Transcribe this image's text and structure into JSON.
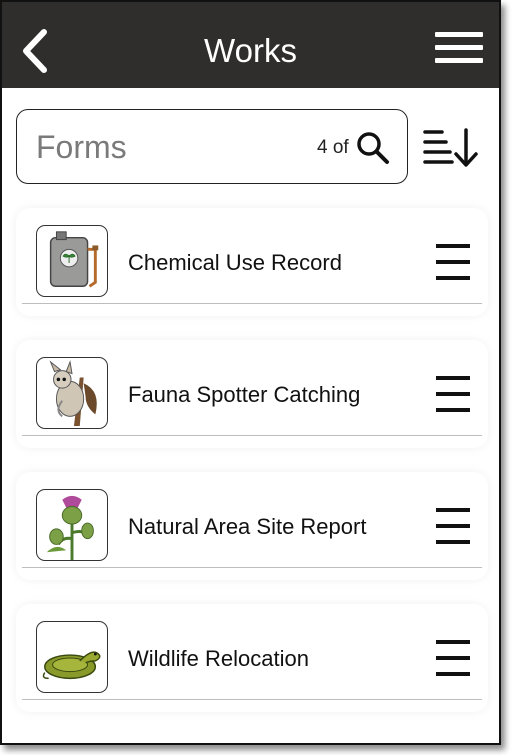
{
  "header": {
    "title": "Works"
  },
  "search": {
    "placeholder": "Forms",
    "count_text": "4 of"
  },
  "items": [
    {
      "label": "Chemical Use Record",
      "icon": "chemical-sprayer-icon"
    },
    {
      "label": "Fauna Spotter Catching",
      "icon": "possum-icon"
    },
    {
      "label": "Natural Area Site Report",
      "icon": "thistle-icon"
    },
    {
      "label": "Wildlife Relocation",
      "icon": "snake-icon"
    }
  ]
}
